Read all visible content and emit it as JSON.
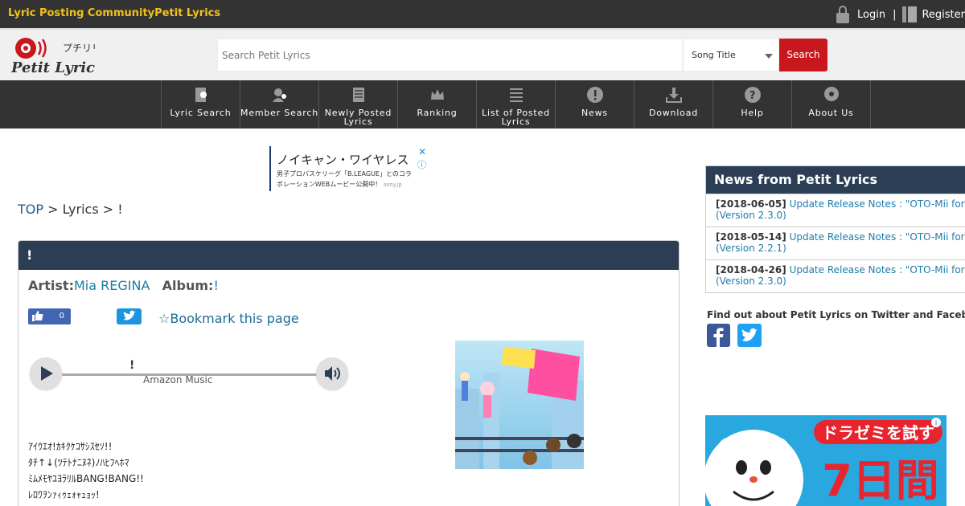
{
  "topbar": {
    "site_title": "Lyric Posting CommunityPetit Lyrics",
    "login": "Login",
    "separator": "|",
    "register": "Register"
  },
  "logo": {
    "kana": "プチリリ",
    "brand": "Petit Lyrics"
  },
  "search": {
    "placeholder": "Search Petit Lyrics",
    "type_selected": "Song Title",
    "button": "Search"
  },
  "nav": {
    "items": [
      {
        "label": "Lyric Search",
        "icon": "lyric-search-icon"
      },
      {
        "label": "Member Search",
        "icon": "member-search-icon"
      },
      {
        "label": "Newly Posted Lyrics",
        "icon": "newly-posted-icon"
      },
      {
        "label": "Ranking",
        "icon": "crown-icon"
      },
      {
        "label": "List of Posted Lyrics",
        "icon": "list-icon"
      },
      {
        "label": "News",
        "icon": "exclamation-icon"
      },
      {
        "label": "Download",
        "icon": "download-icon"
      },
      {
        "label": "Help",
        "icon": "question-icon"
      },
      {
        "label": "About Us",
        "icon": "about-icon"
      }
    ]
  },
  "ad_top": {
    "title": "ノイキャン・ワイヤレス",
    "line1": "男子プロバスケリーグ「B.LEAGUE」とのコラ",
    "line2": "ボレーションWEBムービー公開中！",
    "domain": "sony.jp",
    "close": "✕",
    "info": "ⓘ"
  },
  "breadcrumb": {
    "top": "TOP",
    "sep1": " > ",
    "lyrics": "Lyrics",
    "sep2": " > ",
    "current": "!"
  },
  "song": {
    "title": "!",
    "artist_label": "Artist:",
    "artist": "Mia REGINA",
    "album_label": "Album:",
    "album": "!",
    "like_count": "0",
    "bookmark": "☆Bookmark this page"
  },
  "player": {
    "title": "!",
    "source": "Amazon Music",
    "progress": 0
  },
  "lyrics": [
    "ｱｲｳｴｵ!ｶｷｸｹｺｻｼｽｾｿ!!",
    "ﾀﾁ↑↓(ﾂﾃﾄﾅﾆﾇﾈ)ﾉﾊﾋﾌﾍﾎﾏ",
    "ﾐﾑﾒﾓﾔﾕﾖﾗﾘﾙBANG!BANG!!",
    "ﾚﾛﾜｦﾝｧｨｩｪｫｬｭｮｯ!"
  ],
  "news": {
    "title": "News from Petit Lyrics",
    "items": [
      {
        "date": "[2018-06-05]",
        "text": "Update Release Notes : \"OTO-Mii for",
        "version": "(Version 2.3.0)"
      },
      {
        "date": "[2018-05-14]",
        "text": "Update Release Notes : \"OTO-Mii for",
        "version": "(Version 2.2.1)"
      },
      {
        "date": "[2018-04-26]",
        "text": "Update Release Notes : \"OTO-Mii for",
        "version": "(Version 2.3.0)"
      }
    ]
  },
  "social": {
    "title": "Find out about Petit Lyrics on Twitter and Faceb"
  },
  "ad_side": {
    "line1": "ドラゼミを試す",
    "line2": "7日間"
  },
  "colors": {
    "topbar": "#333333",
    "site_title": "#f1c21b",
    "search_button": "#c9171e",
    "panel_header": "#2c3e55",
    "link": "#1c7ca8"
  }
}
